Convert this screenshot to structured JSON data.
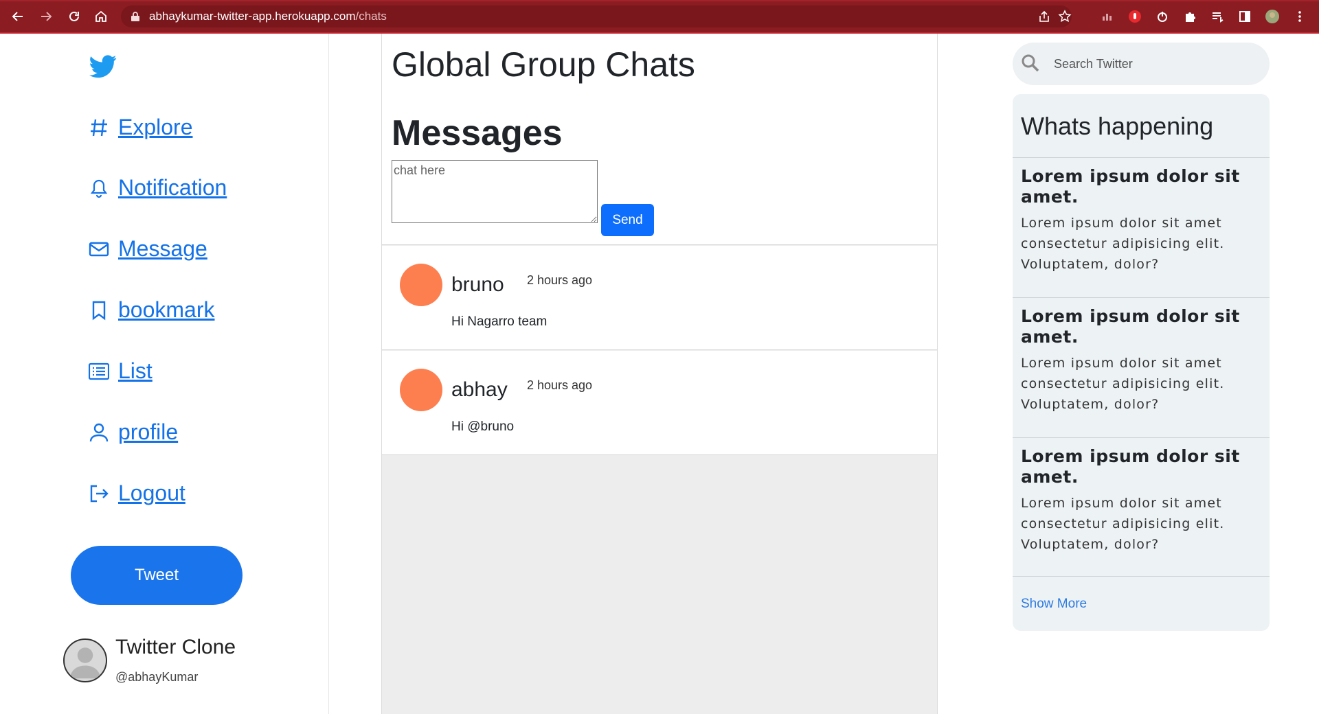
{
  "browser": {
    "url_host": "abhaykumar-twitter-app.herokuapp.com",
    "url_path": "/chats"
  },
  "sidebar": {
    "items": [
      {
        "label": " Explore",
        "icon": "hash-icon"
      },
      {
        "label": " Notification",
        "icon": "bell-icon"
      },
      {
        "label": " Message",
        "icon": "envelope-icon"
      },
      {
        "label": " bookmark",
        "icon": "bookmark-icon"
      },
      {
        "label": " List",
        "icon": "list-icon"
      },
      {
        "label": " profile",
        "icon": "person-icon"
      },
      {
        "label": " Logout",
        "icon": "logout-icon"
      }
    ],
    "tweet_label": "Tweet",
    "profile": {
      "name": "Twitter Clone",
      "handle": "@abhayKumar"
    }
  },
  "main": {
    "title": "Global Group Chats",
    "messages_heading": "Messages",
    "chat_placeholder": "chat here",
    "send_label": "Send",
    "messages": [
      {
        "user": "bruno",
        "time": "2 hours ago",
        "text": "Hi Nagarro team",
        "avatar_color": "#fd7f4f"
      },
      {
        "user": "abhay",
        "time": "2 hours ago",
        "text": "Hi @bruno",
        "avatar_color": "#fd7f4f"
      }
    ]
  },
  "right": {
    "search_placeholder": "Search Twitter",
    "happening_title": "Whats happening",
    "items": [
      {
        "title": "Lorem ipsum dolor sit amet.",
        "body": "Lorem ipsum dolor sit amet consectetur adipisicing elit. Voluptatem, dolor?"
      },
      {
        "title": "Lorem ipsum dolor sit amet.",
        "body": "Lorem ipsum dolor sit amet consectetur adipisicing elit. Voluptatem, dolor?"
      },
      {
        "title": "Lorem ipsum dolor sit amet.",
        "body": "Lorem ipsum dolor sit amet consectetur adipisicing elit. Voluptatem, dolor?"
      }
    ],
    "show_more": "Show More"
  },
  "colors": {
    "brand_blue": "#1a75ec",
    "chrome_red": "#8b1c22",
    "avatar_orange": "#fd7f4f"
  }
}
